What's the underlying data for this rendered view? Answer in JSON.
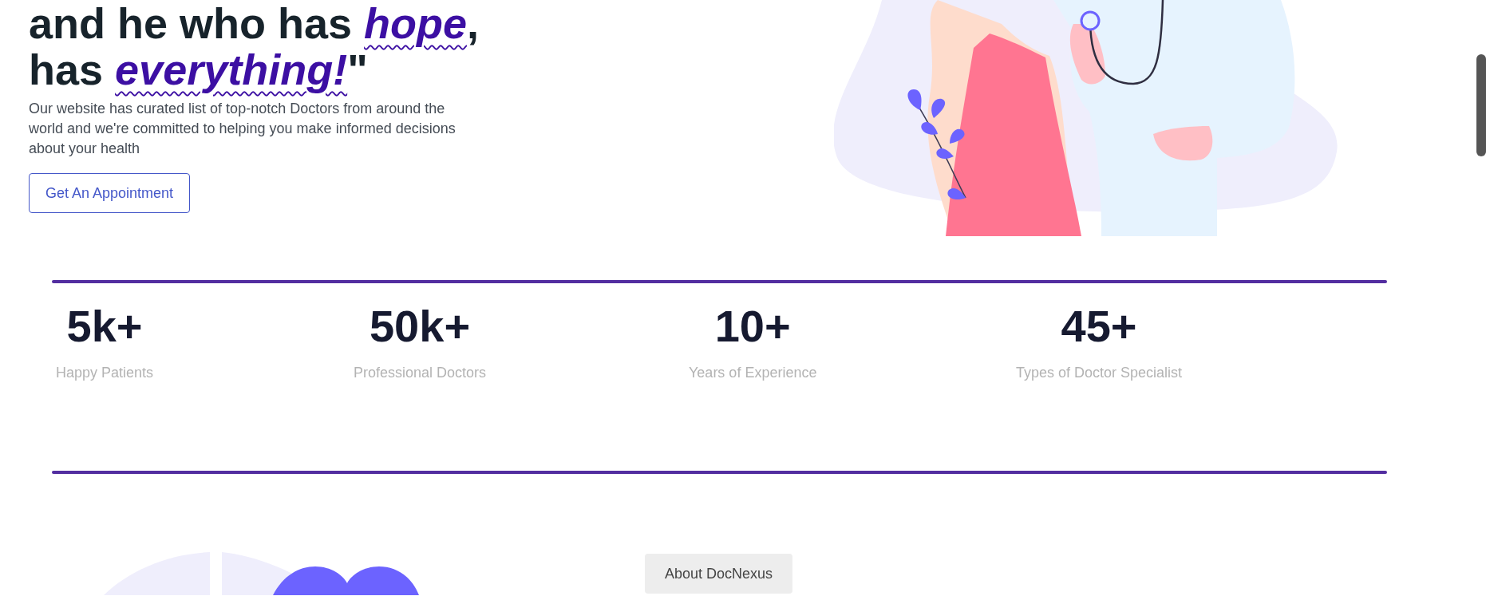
{
  "hero": {
    "heading_lines": [
      "and he who has *hope*,",
      "has *everything!*\""
    ],
    "description": "Our website has curated list of top-notch Doctors from around the world and we're committed to helping you make informed decisions about your health",
    "cta_button": "Get An Appointment"
  },
  "stats": [
    {
      "value": "5k+",
      "label": "Happy Patients"
    },
    {
      "value": "50k+",
      "label": "Professional Doctors"
    },
    {
      "value": "10+",
      "label": "Years of Experience"
    },
    {
      "value": "45+",
      "label": "Types of Doctor Specialist"
    }
  ],
  "about": {
    "badge": "About DocNexus"
  }
}
